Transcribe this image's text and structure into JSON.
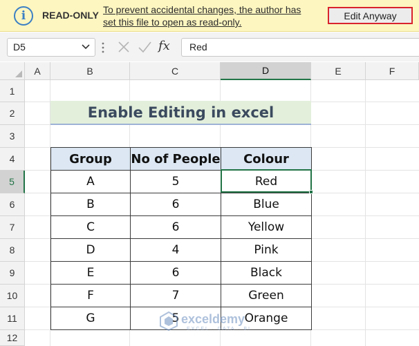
{
  "banner": {
    "label": "READ-ONLY",
    "message": "To prevent accidental changes, the author has set this file to open as read-only.",
    "button": "Edit Anyway"
  },
  "formula_bar": {
    "name_box": "D5",
    "formula": "Red"
  },
  "columns": [
    "A",
    "B",
    "C",
    "D",
    "E",
    "F"
  ],
  "rows": [
    "1",
    "2",
    "3",
    "4",
    "5",
    "6",
    "7",
    "8",
    "9",
    "10",
    "11",
    "12"
  ],
  "active_cell": "D5",
  "sheet": {
    "title": "Enable Editing in excel",
    "headers": [
      "Group",
      "No of People",
      "Colour"
    ],
    "data": [
      [
        "A",
        "5",
        "Red"
      ],
      [
        "B",
        "6",
        "Blue"
      ],
      [
        "C",
        "6",
        "Yellow"
      ],
      [
        "D",
        "4",
        "Pink"
      ],
      [
        "E",
        "6",
        "Black"
      ],
      [
        "F",
        "7",
        "Green"
      ],
      [
        "G",
        "5",
        "Orange"
      ]
    ]
  },
  "watermark": {
    "brand": "exceldemy",
    "tagline": "EXCEL · DATA · BI"
  },
  "colors": {
    "accent_green": "#217346",
    "banner_bg": "#fdf6c0",
    "header_fill": "#dce7f3",
    "title_fill": "#e3efdb",
    "button_outline": "#d9232d"
  }
}
